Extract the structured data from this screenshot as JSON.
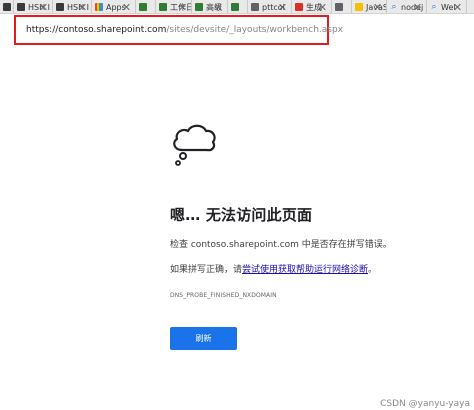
{
  "tabs": [
    {
      "label": "",
      "icon": "dark-tab-icon",
      "fav": "dark",
      "width": 14
    },
    {
      "label": "HSH I",
      "icon": "page-icon",
      "fav": "dark",
      "width": 39
    },
    {
      "label": "HSH I",
      "icon": "page-icon",
      "fav": "dark",
      "width": 39
    },
    {
      "label": "Apps",
      "icon": "apps-grid-icon",
      "fav": "grid",
      "width": 44
    },
    {
      "label": "",
      "icon": "green-tab-icon",
      "fav": "green",
      "width": 20
    },
    {
      "label": "工作日",
      "icon": "green-tab-icon",
      "fav": "green",
      "width": 36
    },
    {
      "label": "高级",
      "icon": "green-tab-icon",
      "fav": "green",
      "width": 36
    },
    {
      "label": "",
      "icon": "green-tab-icon",
      "fav": "green",
      "width": 20
    },
    {
      "label": "pttcol",
      "icon": "blank-tab-icon",
      "fav": "gray",
      "width": 44
    },
    {
      "label": "生成",
      "icon": "red-tab-icon",
      "fav": "red",
      "width": 40
    },
    {
      "label": "",
      "icon": "gray-tab-icon",
      "fav": "gray",
      "width": 20
    },
    {
      "label": "JavaS",
      "icon": "js-tab-icon",
      "fav": "yellow",
      "width": 35
    },
    {
      "label": "nodej",
      "icon": "search-icon",
      "fav": "search",
      "width": 40
    },
    {
      "label": "Wel",
      "icon": "search-icon",
      "fav": "search",
      "width": 40
    }
  ],
  "address": {
    "host": "https://contoso.sharepoint.com",
    "path": "/sites/devsite/_layouts/workbench.aspx"
  },
  "error": {
    "title": "嗯… 无法访问此页面",
    "line1": "检查 contoso.sharepoint.com 中是否存在拼写错误。",
    "line2_prefix": "如果拼写正确，请",
    "line2_link": "尝试使用获取帮助运行网络诊断",
    "line2_suffix": "。",
    "code": "DNS_PROBE_FINISHED_NXDOMAIN",
    "reload_label": "刷新"
  },
  "watermark": "CSDN @yanyu-yaya"
}
